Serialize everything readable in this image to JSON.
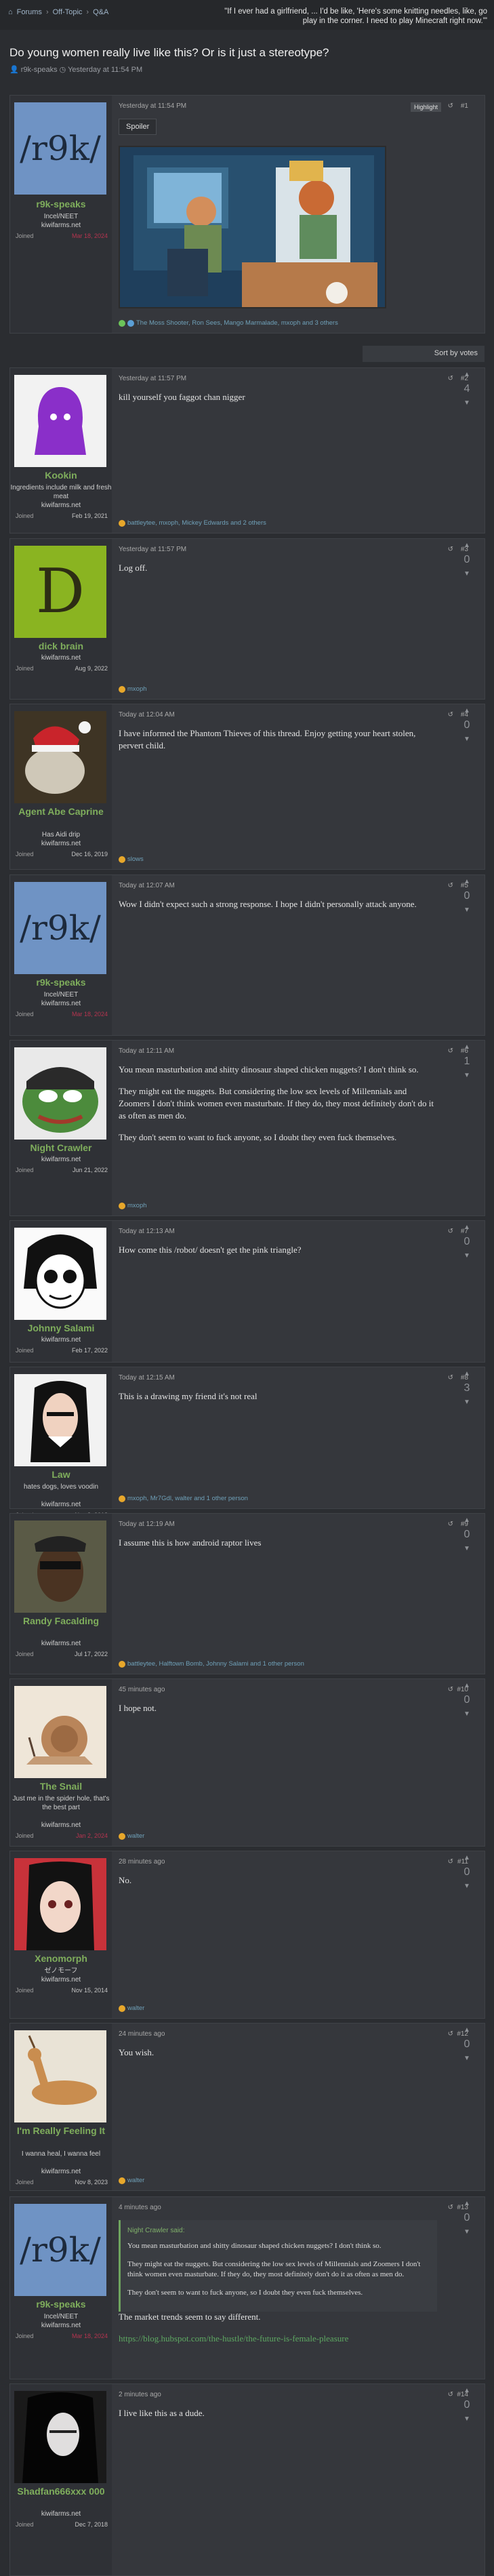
{
  "breadcrumb": {
    "items": [
      "Forums",
      "Off-Topic",
      "Q&A"
    ]
  },
  "header_quote": "\"If I ever had a girlfriend, ... I'd be like, 'Here's some knitting needles, like, go play in the corner. I need to play Minecraft right now.'\"",
  "thread": {
    "title": "Do young women really live like this? Or is it just a stereotype?",
    "author": "r9k-speaks",
    "date": "Yesterday at 11:54 PM"
  },
  "sort_label": "Sort by votes",
  "op": {
    "avatar_text": "/r9k/",
    "username": "r9k-speaks",
    "user_title": "Incel/NEET",
    "site": "kiwifarms.net",
    "joined_label": "Joined",
    "joined_date": "Mar 18, 2024",
    "time": "Yesterday at 11:54 PM",
    "highlight": "Highlight",
    "num": "#1",
    "spoiler": "Spoiler",
    "reactions": "The Moss Shooter, Ron Sees, Mango Marmalade, mxoph and 3 others"
  },
  "posts": [
    {
      "username": "Kookin",
      "user_title": "Ingredients include milk and fresh meat",
      "site": "kiwifarms.net",
      "joined_label": "Joined",
      "joined_date": "Feb 19, 2021",
      "time": "Yesterday at 11:57 PM",
      "num": "#2",
      "votes": "4",
      "text": [
        "kill yourself you faggot chan nigger"
      ],
      "reactions": "battleytee, mxoph, Mickey Edwards and 2 others"
    },
    {
      "username": "dick brain",
      "user_title": "",
      "site": "kiwifarms.net",
      "joined_label": "Joined",
      "joined_date": "Aug 9, 2022",
      "time": "Yesterday at 11:57 PM",
      "num": "#3",
      "votes": "0",
      "text": [
        "Log off."
      ],
      "reactions": "mxoph"
    },
    {
      "username": "Agent Abe Caprine",
      "user_title": "Has Aidi drip",
      "site": "kiwifarms.net",
      "joined_label": "Joined",
      "joined_date": "Dec 16, 2019",
      "time": "Today at 12:04 AM",
      "num": "#4",
      "votes": "0",
      "text": [
        "I have informed the Phantom Thieves of this thread. Enjoy getting your heart stolen, pervert child."
      ],
      "reactions": "slows"
    },
    {
      "username": "r9k-speaks",
      "user_title": "Incel/NEET",
      "site": "kiwifarms.net",
      "joined_label": "Joined",
      "joined_date": "Mar 18, 2024",
      "time": "Today at 12:07 AM",
      "num": "#5",
      "votes": "0",
      "text": [
        "Wow I didn't expect such a strong response. I hope I didn't personally attack anyone."
      ],
      "reactions": ""
    },
    {
      "username": "Night Crawler",
      "user_title": "",
      "site": "kiwifarms.net",
      "joined_label": "Joined",
      "joined_date": "Jun 21, 2022",
      "time": "Today at 12:11 AM",
      "num": "#6",
      "votes": "1",
      "text": [
        "You mean masturbation and shitty dinosaur shaped chicken nuggets? I don't think so.",
        "They might eat the nuggets. But considering the low sex levels of Millennials and Zoomers I don't think women even masturbate. If they do, they most definitely don't do it as often as men do.",
        "They don't seem to want to fuck anyone, so I doubt they even fuck themselves."
      ],
      "reactions": "mxoph"
    },
    {
      "username": "Johnny Salami",
      "user_title": "",
      "site": "kiwifarms.net",
      "joined_label": "Joined",
      "joined_date": "Feb 17, 2022",
      "time": "Today at 12:13 AM",
      "num": "#7",
      "votes": "0",
      "text": [
        "How come this /robot/ doesn't get the pink triangle?"
      ],
      "reactions": ""
    },
    {
      "username": "Law",
      "user_title": "hates dogs, loves voodin",
      "site": "kiwifarms.net",
      "joined_label": "Joined",
      "joined_date": "Nov 8, 2018",
      "time": "Today at 12:15 AM",
      "num": "#8",
      "votes": "3",
      "text": [
        "This is a drawing my friend it's not real"
      ],
      "reactions": "mxoph, Mr7Gdl, walter and 1 other person"
    },
    {
      "username": "Randy Facalding",
      "user_title": "",
      "site": "kiwifarms.net",
      "joined_label": "Joined",
      "joined_date": "Jul 17, 2022",
      "time": "Today at 12:19 AM",
      "num": "#9",
      "votes": "0",
      "text": [
        "I assume this is how android raptor lives"
      ],
      "reactions": "battleytee, Halftown Bomb, Johnny Salami and 1 other person"
    },
    {
      "username": "The Snail",
      "user_title": "Just me in the spider hole, that's the best part",
      "site": "kiwifarms.net",
      "joined_label": "Joined",
      "joined_date": "Jan 2, 2024",
      "time": "45 minutes ago",
      "num": "#10",
      "votes": "0",
      "text": [
        "I hope not."
      ],
      "reactions": "walter"
    },
    {
      "username": "Xenomorph",
      "user_title": "ゼノモーフ",
      "site": "kiwifarms.net",
      "joined_label": "Joined",
      "joined_date": "Nov 15, 2014",
      "time": "28 minutes ago",
      "num": "#11",
      "votes": "0",
      "text": [
        "No."
      ],
      "reactions": "walter"
    },
    {
      "username": "I'm Really Feeling It",
      "user_title": "I wanna heal, I wanna feel",
      "site": "kiwifarms.net",
      "joined_label": "Joined",
      "joined_date": "Nov 8, 2023",
      "time": "24 minutes ago",
      "num": "#12",
      "votes": "0",
      "text": [
        "You wish."
      ],
      "reactions": "walter"
    },
    {
      "username": "r9k-speaks",
      "user_title": "Incel/NEET",
      "site": "kiwifarms.net",
      "joined_label": "Joined",
      "joined_date": "Mar 18, 2024",
      "time": "4 minutes ago",
      "num": "#13",
      "votes": "0",
      "quote_head": "Night Crawler said:",
      "quote": [
        "You mean masturbation and shitty dinosaur shaped chicken nuggets? I don't think so.",
        "They might eat the nuggets. But considering the low sex levels of Millennials and Zoomers I don't think women even masturbate. If they do, they most definitely don't do it as often as men do.",
        "They don't seem to want to fuck anyone, so I doubt they even fuck themselves."
      ],
      "text": [
        "The market trends seem to say different."
      ],
      "link": "https://blog.hubspot.com/the-hustle/the-future-is-female-pleasure",
      "reactions": ""
    },
    {
      "username": "Shadfan666xxx 000",
      "user_title": "",
      "site": "kiwifarms.net",
      "joined_label": "Joined",
      "joined_date": "Dec 7, 2018",
      "time": "2 minutes ago",
      "num": "#14",
      "votes": "0",
      "text": [
        "I live like this as a dude."
      ],
      "reactions": ""
    }
  ]
}
